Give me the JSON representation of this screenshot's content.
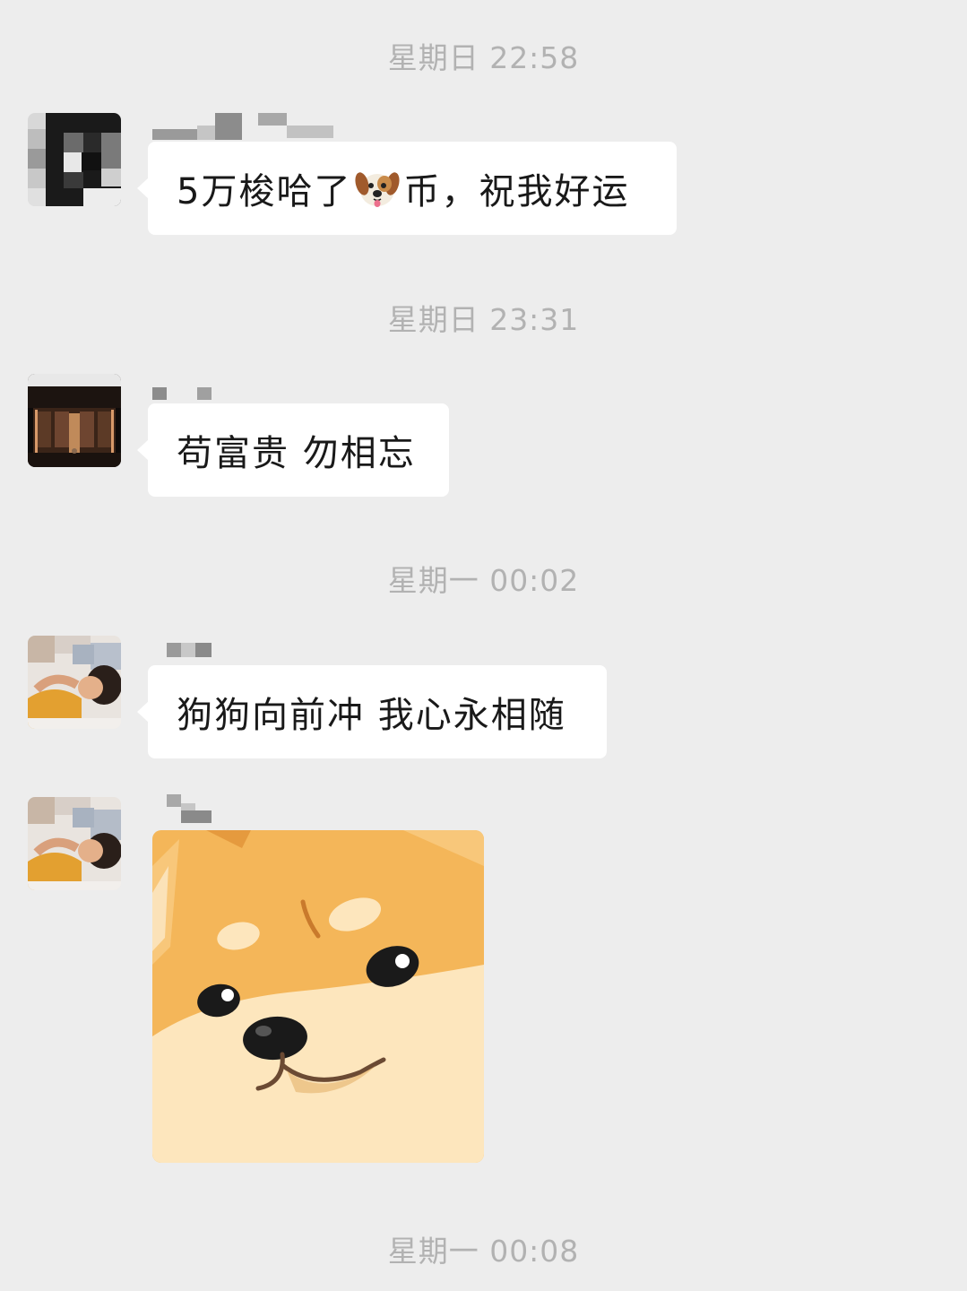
{
  "timestamps": {
    "t1": "星期日 22:58",
    "t2": "星期日 23:31",
    "t3": "星期一 00:02",
    "t4": "星期一 00:08"
  },
  "messages": [
    {
      "text_before": "5万梭哈了",
      "emoji": "dog-face-emoji",
      "text_after": "币，祝我好运"
    },
    {
      "text": "苟富贵 勿相忘"
    },
    {
      "text": "狗狗向前冲 我心永相随"
    },
    {
      "sticker": "shiba-inu-dog-sticker"
    }
  ],
  "colors": {
    "background": "#ededed",
    "bubble": "#ffffff",
    "text": "#191919",
    "timestamp": "#b2b2b2"
  }
}
